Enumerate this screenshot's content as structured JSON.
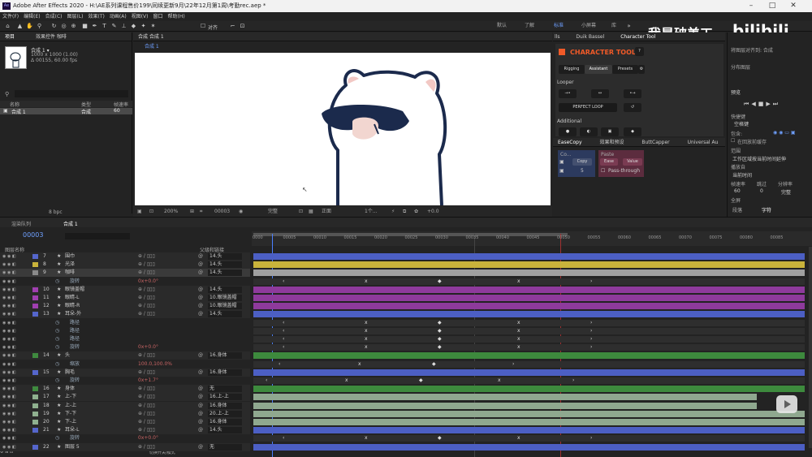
{
  "window": {
    "title": "Adobe After Effects 2020 - H:\\AE系列课程售价199\\同续更新9月\\22年12月第1周\\考勤rec.aep *",
    "app_icon": "Ae"
  },
  "menu": [
    "文件(F)",
    "编辑(E)",
    "合成(C)",
    "图层(L)",
    "效果(T)",
    "动画(A)",
    "视图(V)",
    "窗口",
    "帮助(H)"
  ],
  "workspaces": [
    "默认",
    "了解",
    "标准",
    "小屏幕",
    "库"
  ],
  "toolbar": {
    "snap_label": "对齐"
  },
  "project": {
    "tab_project": "项目",
    "tab_effects": "效果控件 咖啡",
    "comp_name": "合成 1 ▾",
    "comp_info1": "1000 x 1000 (1.00)",
    "comp_info2": "Δ 00155, 60.00 fps",
    "col_name": "名称",
    "col_type": "类型",
    "col_rate": "帧速率",
    "item_name": "合成 1",
    "item_type": "合成",
    "item_rate": "60",
    "bpc": "8 bpc"
  },
  "composition": {
    "tab": "合成 合成 1",
    "breadcrumb": "合成 1",
    "zoom": "200%",
    "timecode": "00003",
    "quality": "完整",
    "view": "正面",
    "views": "1个...",
    "exposure": "+0.0"
  },
  "character_tool": {
    "tabs": [
      "lls",
      "Duik Bassel",
      "Character Tool"
    ],
    "title": "CHARACTER TOOL",
    "help": "?",
    "nav": [
      "Rigging",
      "Assistant",
      "Presets"
    ],
    "looper": "Looper",
    "perfect_loop": "PERFECT LOOP",
    "additional": "Additional"
  },
  "ease_copy": {
    "tabs": [
      "EaseCopy",
      "效果和预设",
      "ButtCapper",
      "Universal Au"
    ],
    "co_label": "Co...",
    "copy_btn": "Copy",
    "copy_value": "5",
    "paste_label": "Paste",
    "ease_btn": "Ease",
    "value_btn": "Value",
    "passthrough": "Pass-through"
  },
  "right_panel": {
    "info": "我是破美工",
    "align_label": "将图层对齐到: 合成",
    "distribute": "分布图层",
    "preview": "预览",
    "shortcut": "快捷键",
    "shortcut_val": "空格键",
    "include": "包含:",
    "loop_cache": "在回放前缓存",
    "range": "范围",
    "range_val": "工作区域按当前时间延伸",
    "playfrom": "播放自",
    "playfrom_val": "当前时间",
    "fps_label": "帧速率",
    "skip": "跳过",
    "res": "分辨率",
    "fps_val": "60",
    "skip_val": "0",
    "res_val": "完整",
    "fullscreen": "全屏",
    "tab_para": "段落",
    "tab_char": "字符"
  },
  "timeline": {
    "tab_render": "渲染队列",
    "tab_comp": "合成 1",
    "timecode": "00003",
    "col_name": "图层名称",
    "col_parent": "父级和链接",
    "bottom_label": "切换开关/模式",
    "ruler": [
      "0000",
      "00005",
      "00010",
      "00015",
      "00020",
      "00025",
      "00030",
      "00035",
      "00040",
      "00045",
      "00050",
      "00055",
      "00060",
      "00065",
      "00070",
      "00075",
      "00080",
      "00085"
    ],
    "layers": [
      {
        "num": "7",
        "name": "围巾",
        "parent": "14.头",
        "color": "#5566cc",
        "bar": "#4c5fc4",
        "kind": "layer"
      },
      {
        "num": "8",
        "name": "光泽",
        "parent": "14.头",
        "color": "#c9b33b",
        "bar": "#c9b33b",
        "kind": "layer"
      },
      {
        "num": "9",
        "name": "咖啡",
        "parent": "14.头",
        "color": "#8a8a8a",
        "bar": "#a0a0a0",
        "kind": "layer"
      },
      {
        "num": "",
        "name": "旋转",
        "parent": "",
        "color": "",
        "bar": "",
        "kind": "prop",
        "value": "0x+0.0°"
      },
      {
        "num": "10",
        "name": "眼镜盖帽",
        "parent": "14.头",
        "color": "#a03fb0",
        "bar": "#8e3a9c",
        "kind": "layer"
      },
      {
        "num": "11",
        "name": "眼睛-L",
        "parent": "10.眼镜盖帽",
        "color": "#a03fb0",
        "bar": "#8e3a9c",
        "kind": "layer"
      },
      {
        "num": "12",
        "name": "眼睛-R",
        "parent": "10.眼镜盖帽",
        "color": "#a03fb0",
        "bar": "#8e3a9c",
        "kind": "layer"
      },
      {
        "num": "13",
        "name": "耳朵-外",
        "parent": "14.头",
        "color": "#5566cc",
        "bar": "#4c5fc4",
        "kind": "layer"
      },
      {
        "num": "",
        "name": "路径",
        "parent": "",
        "color": "",
        "bar": "",
        "kind": "prop"
      },
      {
        "num": "",
        "name": "路径",
        "parent": "",
        "color": "",
        "bar": "",
        "kind": "prop"
      },
      {
        "num": "",
        "name": "路径",
        "parent": "",
        "color": "",
        "bar": "",
        "kind": "prop"
      },
      {
        "num": "",
        "name": "旋转",
        "parent": "",
        "color": "",
        "bar": "",
        "kind": "prop",
        "value": "0x+0.0°"
      },
      {
        "num": "14",
        "name": "头",
        "parent": "16.身体",
        "color": "#3f8a3f",
        "bar": "#3d8a3d",
        "kind": "layer"
      },
      {
        "num": "",
        "name": "缩放",
        "parent": "",
        "color": "",
        "bar": "",
        "kind": "prop",
        "value": "100.0,100.0%"
      },
      {
        "num": "15",
        "name": "胸毛",
        "parent": "16.身体",
        "color": "#5566cc",
        "bar": "#4c5fc4",
        "kind": "layer"
      },
      {
        "num": "",
        "name": "旋转",
        "parent": "",
        "color": "",
        "bar": "",
        "kind": "prop",
        "value": "0x+1.7°"
      },
      {
        "num": "16",
        "name": "身体",
        "parent": "无",
        "color": "#3f8a3f",
        "bar": "#3d8a3d",
        "kind": "layer"
      },
      {
        "num": "17",
        "name": "上-下",
        "parent": "16.上-上",
        "color": "#8fb08f",
        "bar": "#8fa88f",
        "kind": "layer"
      },
      {
        "num": "18",
        "name": "上-上",
        "parent": "16.身体",
        "color": "#8fb08f",
        "bar": "#8fa88f",
        "kind": "layer"
      },
      {
        "num": "19",
        "name": "下-下",
        "parent": "20.上-上",
        "color": "#8fb08f",
        "bar": "#8fa88f",
        "kind": "layer"
      },
      {
        "num": "20",
        "name": "下-上",
        "parent": "16.身体",
        "color": "#8fb08f",
        "bar": "#8fa88f",
        "kind": "layer"
      },
      {
        "num": "21",
        "name": "耳朵-L",
        "parent": "14.头",
        "color": "#5566cc",
        "bar": "#4c5fc4",
        "kind": "layer"
      },
      {
        "num": "",
        "name": "旋转",
        "parent": "",
        "color": "",
        "bar": "",
        "kind": "prop",
        "value": "0x+0.0°"
      },
      {
        "num": "22",
        "name": "图层 5",
        "parent": "无",
        "color": "#5566cc",
        "bar": "#4c5fc4",
        "kind": "layer"
      }
    ]
  }
}
